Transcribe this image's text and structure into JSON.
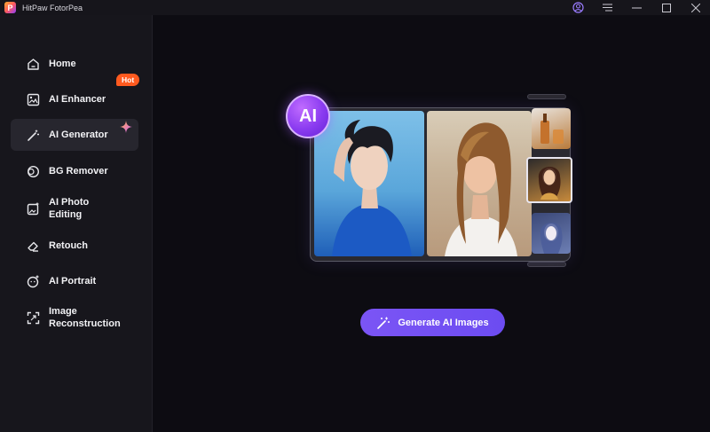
{
  "app": {
    "title": "HitPaw FotorPea",
    "logo_letter": "P"
  },
  "sidebar": {
    "items": [
      {
        "label": "Home",
        "icon": "home-icon",
        "active": false
      },
      {
        "label": "AI Enhancer",
        "icon": "image-enhance-icon",
        "badge": "Hot",
        "active": false
      },
      {
        "label": "AI Generator",
        "icon": "magic-wand-icon",
        "active": true
      },
      {
        "label": "BG Remover",
        "icon": "bg-remover-icon",
        "active": false
      },
      {
        "label": "AI Photo\nEditing",
        "icon": "photo-edit-icon",
        "active": false
      },
      {
        "label": "Retouch",
        "icon": "eraser-icon",
        "active": false
      },
      {
        "label": "AI Portrait",
        "icon": "portrait-icon",
        "active": false
      },
      {
        "label": "Image\nReconstruction",
        "icon": "reconstruct-icon",
        "active": false
      }
    ]
  },
  "main": {
    "ai_badge": "AI",
    "generate_button": "Generate AI Images"
  },
  "colors": {
    "accent": "#6c4cf1",
    "hot_badge": "#ff5a1f",
    "sidebar_bg": "#17161c",
    "main_bg": "#0d0c12"
  }
}
